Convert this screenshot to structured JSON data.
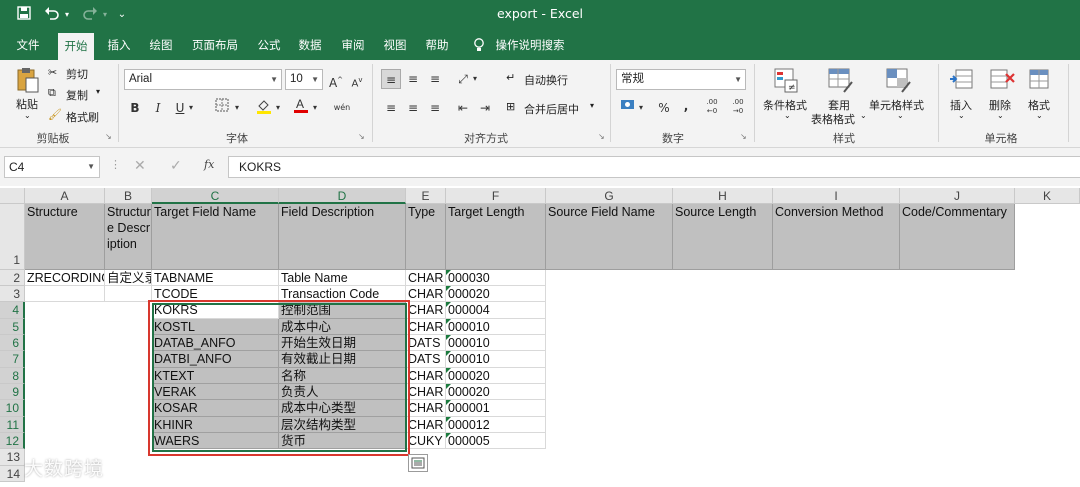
{
  "window": {
    "title": "export  -  Excel",
    "quick_access": [
      "save-icon",
      "undo-icon",
      "redo-icon",
      "customize-icon"
    ]
  },
  "tabs": [
    {
      "label": "文件",
      "active": false
    },
    {
      "label": "开始",
      "active": true
    },
    {
      "label": "插入",
      "active": false
    },
    {
      "label": "绘图",
      "active": false
    },
    {
      "label": "页面布局",
      "active": false
    },
    {
      "label": "公式",
      "active": false
    },
    {
      "label": "数据",
      "active": false
    },
    {
      "label": "审阅",
      "active": false
    },
    {
      "label": "视图",
      "active": false
    },
    {
      "label": "帮助",
      "active": false
    }
  ],
  "tell_me": "操作说明搜索",
  "ribbon": {
    "clipboard": {
      "paste": "粘贴",
      "cut": "剪切",
      "copy": "复制",
      "format_painter": "格式刷",
      "label": "剪贴板"
    },
    "font": {
      "name": "Arial",
      "size": "10",
      "bold": "B",
      "italic": "I",
      "underline": "U",
      "grow": "A",
      "shrink": "A",
      "label": "字体"
    },
    "alignment": {
      "wrap": "自动换行",
      "merge": "合并后居中",
      "label": "对齐方式"
    },
    "number": {
      "format": "常规",
      "percent": "%",
      "comma": ",",
      "inc_dec": ".00",
      "dec_dec": ".00",
      "label": "数字"
    },
    "styles": {
      "conditional": "条件格式",
      "table_1": "套用",
      "table_2": "表格格式",
      "cell_styles": "单元格样式",
      "label": "样式"
    },
    "cells": {
      "insert": "插入",
      "delete": "删除",
      "format": "格式",
      "label": "单元格"
    }
  },
  "formula_bar": {
    "name_box": "C4",
    "formula": "KOKRS",
    "fx": "fx"
  },
  "columns": [
    "A",
    "B",
    "C",
    "D",
    "E",
    "F",
    "G",
    "H",
    "I",
    "J",
    "K"
  ],
  "selected_columns": [
    "C",
    "D"
  ],
  "rows": [
    "1",
    "2",
    "3",
    "4",
    "5",
    "6",
    "7",
    "8",
    "9",
    "10",
    "11",
    "12",
    "13",
    "14"
  ],
  "selected_rows": [
    "4",
    "5",
    "6",
    "7",
    "8",
    "9",
    "10",
    "11",
    "12"
  ],
  "header_row": [
    "Structure",
    "Structure Description",
    "Target Field Name",
    "Field Description",
    "Type",
    "Target Length",
    "Source Field Name",
    "Source Length",
    "Conversion Method",
    "Code/Commentary"
  ],
  "data_rows": [
    {
      "a": "ZRECORDING",
      "b": "自定义录",
      "c": "TABNAME",
      "d": "Table Name",
      "e": "CHAR",
      "f": "000030"
    },
    {
      "a": "",
      "b": "",
      "c": "TCODE",
      "d": "Transaction Code",
      "e": "CHAR",
      "f": "000020"
    },
    {
      "a": "",
      "b": "",
      "c": "KOKRS",
      "d": "控制范围",
      "e": "CHAR",
      "f": "000004"
    },
    {
      "a": "",
      "b": "",
      "c": "KOSTL",
      "d": "成本中心",
      "e": "CHAR",
      "f": "000010"
    },
    {
      "a": "",
      "b": "",
      "c": "DATAB_ANFO",
      "d": "开始生效日期",
      "e": "DATS",
      "f": "000010"
    },
    {
      "a": "",
      "b": "",
      "c": "DATBI_ANFO",
      "d": "有效截止日期",
      "e": "DATS",
      "f": "000010"
    },
    {
      "a": "",
      "b": "",
      "c": "KTEXT",
      "d": "名称",
      "e": "CHAR",
      "f": "000020"
    },
    {
      "a": "",
      "b": "",
      "c": "VERAK",
      "d": "负责人",
      "e": "CHAR",
      "f": "000020"
    },
    {
      "a": "",
      "b": "",
      "c": "KOSAR",
      "d": "成本中心类型",
      "e": "CHAR",
      "f": "000001"
    },
    {
      "a": "",
      "b": "",
      "c": "KHINR",
      "d": "层次结构类型",
      "e": "CHAR",
      "f": "000012"
    },
    {
      "a": "",
      "b": "",
      "c": "WAERS",
      "d": "货币",
      "e": "CUKY",
      "f": "000005"
    }
  ],
  "watermark": "大数跨境",
  "colors": {
    "excel_green": "#217346",
    "highlight_red": "#d8382e",
    "header_gray": "#c0c0c0"
  }
}
